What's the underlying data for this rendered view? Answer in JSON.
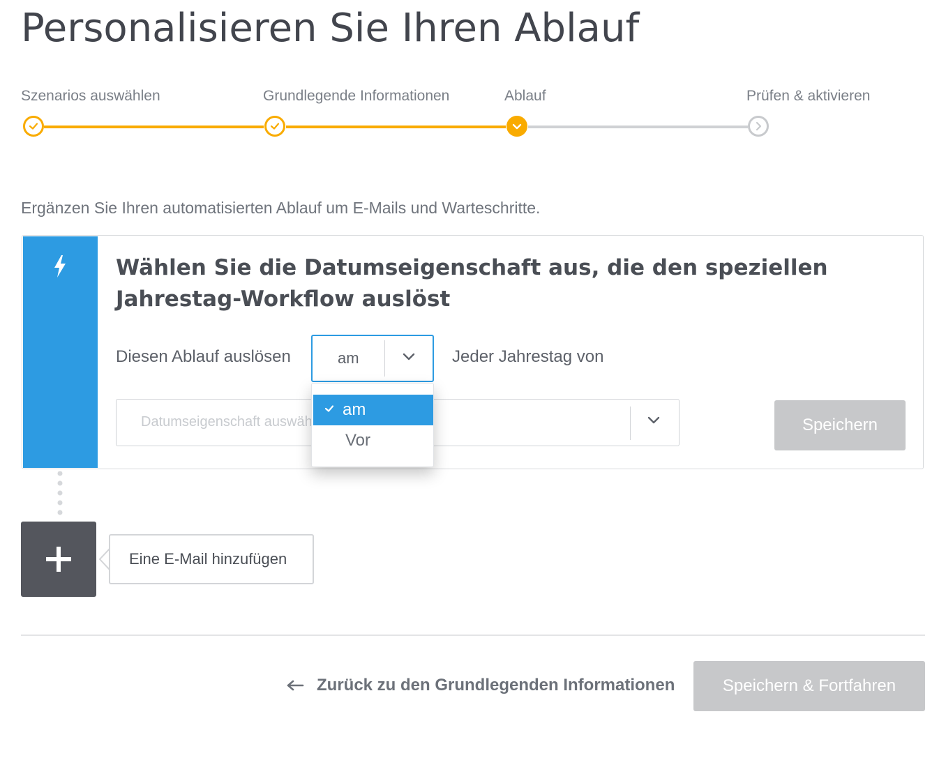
{
  "page": {
    "title": "Personalisieren Sie Ihren Ablauf"
  },
  "stepper": {
    "steps": [
      {
        "label": "Szenarios auswählen",
        "state": "done"
      },
      {
        "label": "Grundlegende Informationen",
        "state": "done"
      },
      {
        "label": "Ablauf",
        "state": "active"
      },
      {
        "label": "Prüfen & aktivieren",
        "state": "todo"
      }
    ]
  },
  "intro": "Ergänzen Sie Ihren automatisierten Ablauf um E-Mails und Warteschritte.",
  "trigger_card": {
    "icon": "lightning-icon",
    "title": "Wählen Sie die Datumseigenschaft aus, die den speziellen Jahrestag-Workflow auslöst",
    "trigger_label": "Diesen Ablauf auslösen",
    "timing_select": {
      "value": "am",
      "options": [
        "am",
        "Vor"
      ],
      "open": true
    },
    "anniversary_label": "Jeder Jahrestag von",
    "date_property_select": {
      "placeholder": "Datumseigenschaft auswählen"
    },
    "save_label": "Speichern"
  },
  "add_email": {
    "label": "Eine E-Mail hinzufügen",
    "icon": "plus-icon"
  },
  "footer": {
    "back_label": "Zurück zu den Grundlegenden Informationen",
    "continue_label": "Speichern & Fortfahren"
  },
  "colors": {
    "accent_blue": "#2d9be2",
    "step_orange": "#f9ab00",
    "disabled_button": "#c7c8ca",
    "title_text": "#42454d"
  }
}
